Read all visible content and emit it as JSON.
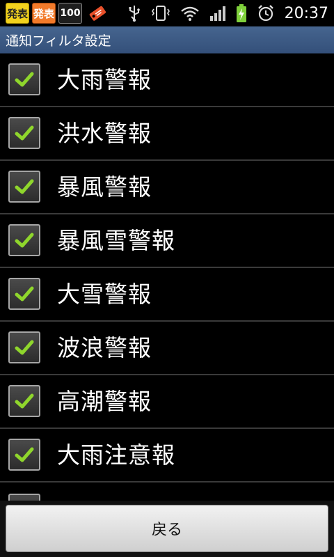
{
  "status_bar": {
    "notifications": [
      {
        "label": "発表",
        "icon": "notification-announce-yellow"
      },
      {
        "label": "発表",
        "icon": "notification-announce-orange"
      },
      {
        "label": "100",
        "icon": "notification-100"
      },
      {
        "label": "",
        "icon": "tag-icon"
      }
    ],
    "icons": [
      "usb-icon",
      "vibrate-icon",
      "wifi-icon",
      "signal-icon",
      "battery-charging-icon",
      "alarm-icon"
    ],
    "clock": "20:37"
  },
  "title_bar": {
    "title": "通知フィルタ設定"
  },
  "list": {
    "items": [
      {
        "label": "大雨警報",
        "checked": true
      },
      {
        "label": "洪水警報",
        "checked": true
      },
      {
        "label": "暴風警報",
        "checked": true
      },
      {
        "label": "暴風雪警報",
        "checked": true
      },
      {
        "label": "大雪警報",
        "checked": true
      },
      {
        "label": "波浪警報",
        "checked": true
      },
      {
        "label": "高潮警報",
        "checked": true
      },
      {
        "label": "大雨注意報",
        "checked": true
      }
    ]
  },
  "bottom": {
    "back_label": "戻る"
  },
  "colors": {
    "title_bar": "#3e5d86",
    "check_mark": "#8fd62c",
    "divider": "#3a3a3a"
  }
}
